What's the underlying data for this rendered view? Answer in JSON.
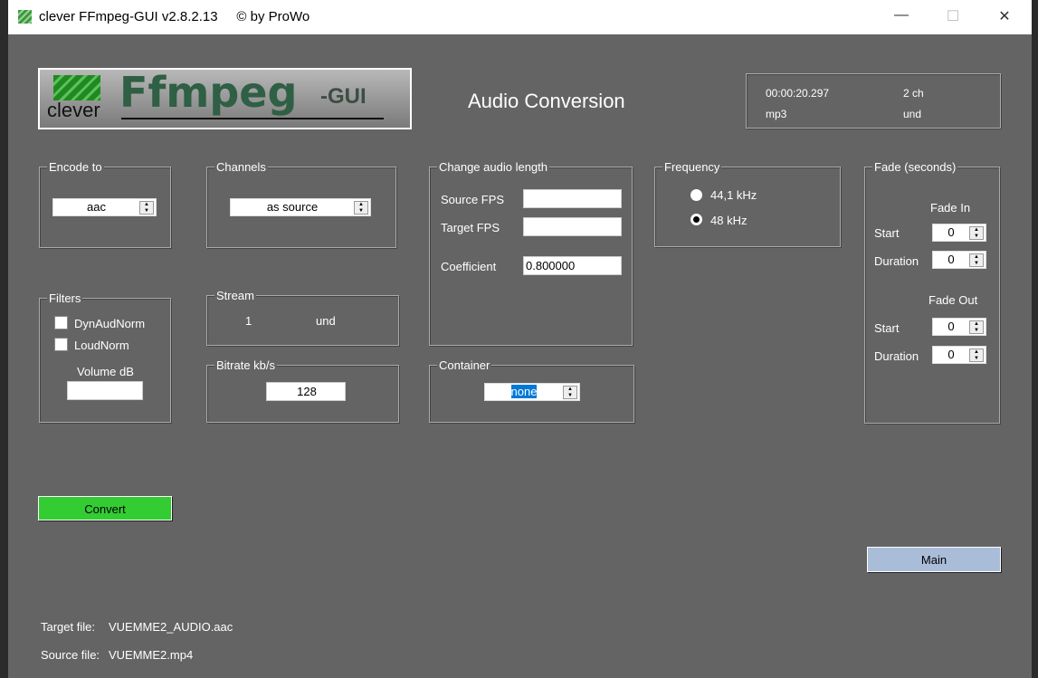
{
  "window": {
    "title": "clever FFmpeg-GUI v2.8.2.13     © by ProWo",
    "min": "—",
    "max": "☐",
    "close": "✕"
  },
  "logo": {
    "clever": "clever",
    "ffmpeg": "Ffmpeg",
    "gui": "-GUI"
  },
  "heading": "Audio Conversion",
  "info": {
    "duration": "00:00:20.297",
    "channels": "2 ch",
    "format": "mp3",
    "language": "und"
  },
  "encode_to": {
    "label": "Encode to",
    "value": "aac"
  },
  "channels": {
    "label": "Channels",
    "value": "as source"
  },
  "filters": {
    "label": "Filters",
    "dynaudnorm": "DynAudNorm",
    "loudnorm": "LoudNorm",
    "volume_label": "Volume dB",
    "volume_value": ""
  },
  "stream": {
    "label": "Stream",
    "index": "1",
    "language": "und"
  },
  "bitrate": {
    "label": "Bitrate kb/s",
    "value": "128"
  },
  "audio_length": {
    "label": "Change audio length",
    "source_fps": "Source FPS",
    "target_fps": "Target FPS",
    "coefficient": "Coefficient",
    "coefficient_value": "0.800000"
  },
  "container": {
    "label": "Container",
    "value": "none"
  },
  "frequency": {
    "label": "Frequency",
    "opt1": "44,1 kHz",
    "opt2": "48 kHz",
    "selected": "48 kHz"
  },
  "fade": {
    "label": "Fade (seconds)",
    "fade_in": "Fade In",
    "fade_out": "Fade Out",
    "start": "Start",
    "duration": "Duration",
    "in_start": "0",
    "in_duration": "0",
    "out_start": "0",
    "out_duration": "0"
  },
  "convert": "Convert",
  "main": "Main",
  "files": {
    "target_label": "Target file:",
    "target": "VUEMME2_AUDIO.aac",
    "source_label": "Source file:",
    "source": "VUEMME2.mp4"
  },
  "colors": {
    "bg": "#646464",
    "convert": "#33cc33",
    "main": "#a9bcd8"
  }
}
